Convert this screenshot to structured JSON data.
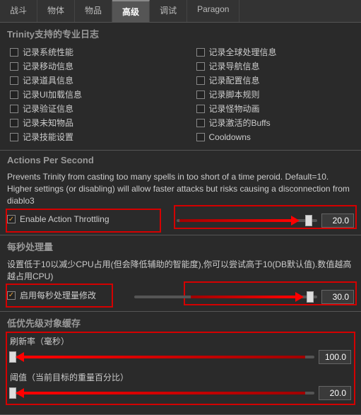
{
  "tabs": {
    "t0": "战斗",
    "t1": "物体",
    "t2": "物品",
    "t3": "高级",
    "t4": "调试",
    "t5": "Paragon"
  },
  "sec1": {
    "title": "Trinity支持的专业日志",
    "left": [
      "记录系统性能",
      "记录移动信息",
      "记录道具信息",
      "记录UI加载信息",
      "记录验证信息",
      "记录未知物品",
      "记录技能设置"
    ],
    "right": [
      "记录全球处理信息",
      "记录导航信息",
      "记录配置信息",
      "记录脚本规则",
      "记录怪物动画",
      "记录激活的Buffs",
      "Cooldowns"
    ]
  },
  "sec2": {
    "title": "Actions Per Second",
    "desc": "Prevents Trinity from casting too many spells in too short of a time peroid. Default=10. Higher settings (or disabling) will allow faster attacks but risks causing a disconnection from diablo3",
    "check_label": "Enable Action Throttling",
    "value": "20.0"
  },
  "sec3": {
    "title": "每秒处理量",
    "desc": "设置低于10以减少CPU占用(但会降低辅助的智能度),你可以尝试高于10(DB默认值).数值越高越占用CPU)",
    "check_label": "启用每秒处理量修改",
    "value": "30.0"
  },
  "sec4": {
    "title": "低优先级对象缓存",
    "label1": "刷新率（毫秒）",
    "value1": "100.0",
    "label2": "阈值（当前目标的重量百分比）",
    "value2": "20.0"
  }
}
